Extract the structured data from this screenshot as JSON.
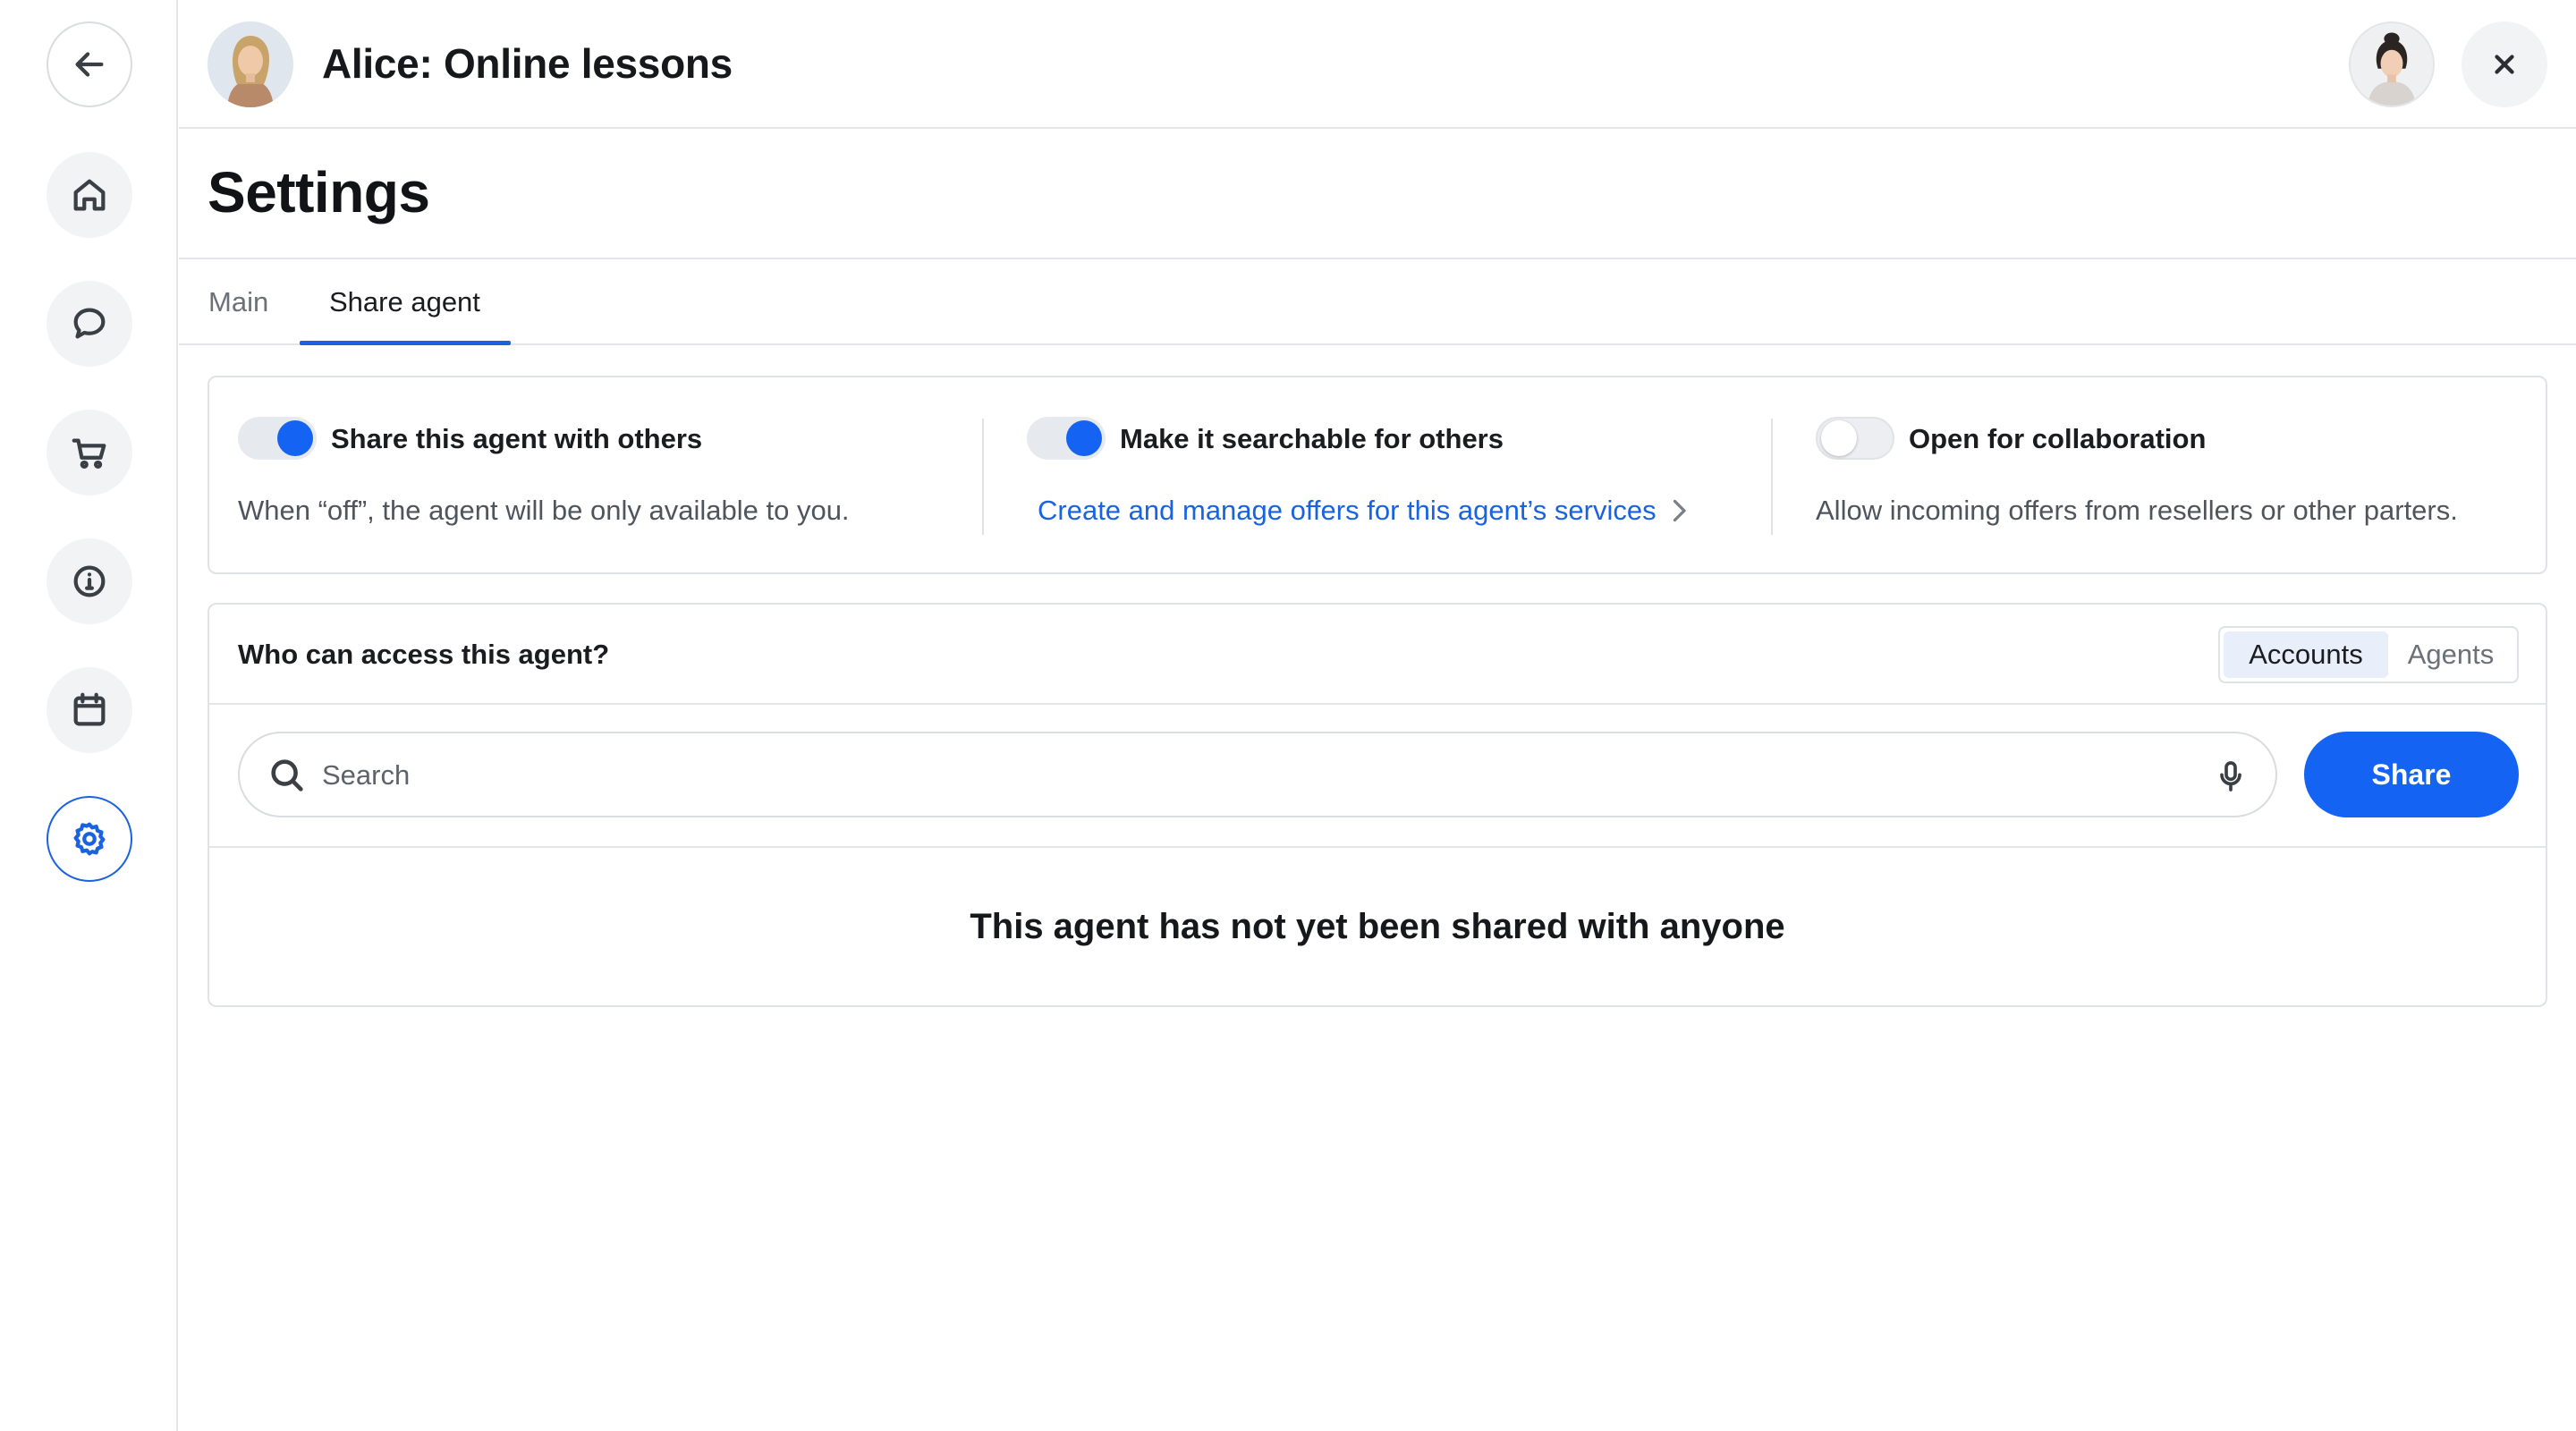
{
  "header": {
    "agent_title": "Alice: Online lessons",
    "agent_avatar": "agent-avatar",
    "user_avatar": "user-avatar"
  },
  "rail": {
    "items": [
      {
        "icon": "arrow-left-icon",
        "name": "back"
      },
      {
        "icon": "home-icon",
        "name": "home"
      },
      {
        "icon": "chat-icon",
        "name": "chat"
      },
      {
        "icon": "cart-icon",
        "name": "cart"
      },
      {
        "icon": "info-icon",
        "name": "info"
      },
      {
        "icon": "calendar-icon",
        "name": "calendar"
      },
      {
        "icon": "gear-icon",
        "name": "settings",
        "active": true
      }
    ]
  },
  "page": {
    "title": "Settings"
  },
  "tabs": [
    {
      "label": "Main",
      "active": false
    },
    {
      "label": "Share agent",
      "active": true
    }
  ],
  "share_options": [
    {
      "label": "Share this agent with others",
      "enabled": true,
      "description": "When “off”, the agent will be only available to you."
    },
    {
      "label": "Make it searchable for others",
      "enabled": true,
      "link": "Create and manage offers for this agent’s services"
    },
    {
      "label": "Open for collaboration",
      "enabled": false,
      "description": "Allow incoming offers from resellers or other parters."
    }
  ],
  "access": {
    "title": "Who can access this agent?",
    "segments": [
      {
        "label": "Accounts",
        "active": true
      },
      {
        "label": "Agents",
        "active": false
      }
    ],
    "search": {
      "placeholder": "Search",
      "value": ""
    },
    "share_label": "Share",
    "empty_message": "This agent has not yet been shared with anyone"
  },
  "colors": {
    "accent": "#1463f3",
    "link": "#1a63e0",
    "border": "#dfe2e6",
    "rail_button_bg": "#f1f3f5"
  }
}
